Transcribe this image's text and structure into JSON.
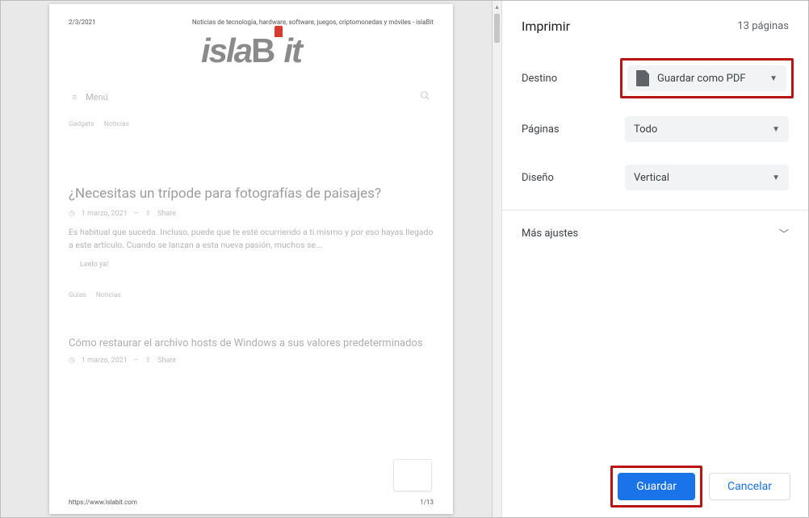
{
  "colors": {
    "accent_blue": "#1a73e8",
    "highlight_red": "#b81414",
    "logo_accent": "#d63b2f"
  },
  "preview": {
    "date": "2/3/2021",
    "site_title": "Noticias de tecnología, hardware, software, juegos, criptomonedas y móviles - islaBit",
    "logo_text_left": "isla",
    "logo_text_right": "it",
    "menu_label": "Menú",
    "tags1": [
      "Gadgets",
      "Noticias"
    ],
    "article1": {
      "title": "¿Necesitas un trípode para fotografías de paisajes?",
      "meta_date": "1 marzo, 2021",
      "meta_sep": "–",
      "meta_share": "Share",
      "body": "Es habitual que suceda. Incluso, puede que te esté ocurriendo a ti mismo y por eso hayas llegado a este artículo. Cuando se lanzan a esta nueva pasión, muchos se...",
      "read": "Leelo ya!"
    },
    "tags2": [
      "Guías",
      "Noticias"
    ],
    "article2": {
      "title": "Cómo restaurar el archivo hosts de Windows a sus valores predeterminados",
      "meta_date": "1 marzo, 2021",
      "meta_sep": "–",
      "meta_share": "Share"
    },
    "footer_url": "https://www.islabit.com",
    "footer_page": "1/13"
  },
  "dialog": {
    "title": "Imprimir",
    "sheet_count": "13 páginas",
    "rows": {
      "destination": {
        "label": "Destino",
        "value": "Guardar como PDF"
      },
      "pages": {
        "label": "Páginas",
        "value": "Todo"
      },
      "layout": {
        "label": "Diseño",
        "value": "Vertical"
      }
    },
    "more_label": "Más ajustes",
    "buttons": {
      "save": "Guardar",
      "cancel": "Cancelar"
    }
  }
}
